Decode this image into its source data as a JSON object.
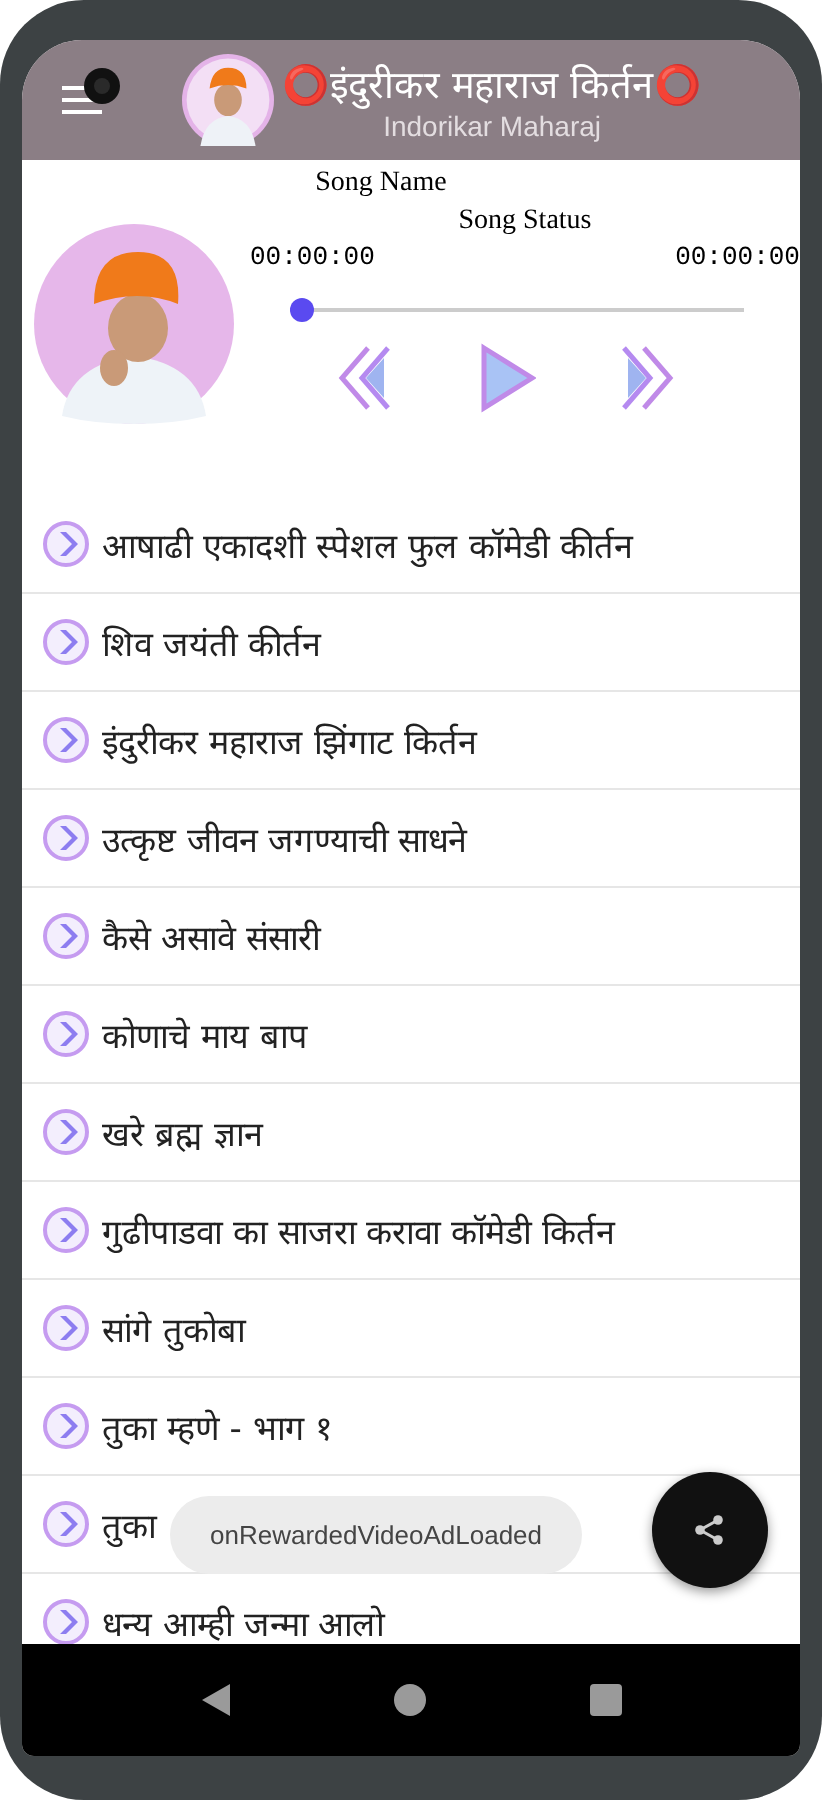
{
  "app_bar": {
    "title": "⭕इंदुरीकर महाराज किर्तन⭕",
    "subtitle": "Indorikar Maharaj"
  },
  "player": {
    "song_name": "Song Name",
    "song_status": "Song Status",
    "elapsed": "00:00:00",
    "duration": "00:00:00",
    "seek": {
      "level": 0
    }
  },
  "songs": [
    {
      "title": "आषाढी एकादशी स्पेशल फुल कॉमेडी कीर्तन"
    },
    {
      "title": "शिव जयंती कीर्तन"
    },
    {
      "title": "इंदुरीकर महाराज झिंगाट किर्तन"
    },
    {
      "title": "उत्कृष्ट जीवन जगण्याची साधने"
    },
    {
      "title": "कैसे असावे संसारी"
    },
    {
      "title": "कोणाचे माय बाप"
    },
    {
      "title": "खरे ब्रह्म ज्ञान"
    },
    {
      "title": "गुढीपाडवा का साजरा करावा कॉमेडी किर्तन"
    },
    {
      "title": "सांगे तुकोबा"
    },
    {
      "title": "तुका म्हणे - भाग १"
    },
    {
      "title": "तुका"
    },
    {
      "title": "धन्य आम्ही जन्मा आलो"
    }
  ],
  "toast": "onRewardedVideoAdLoaded"
}
